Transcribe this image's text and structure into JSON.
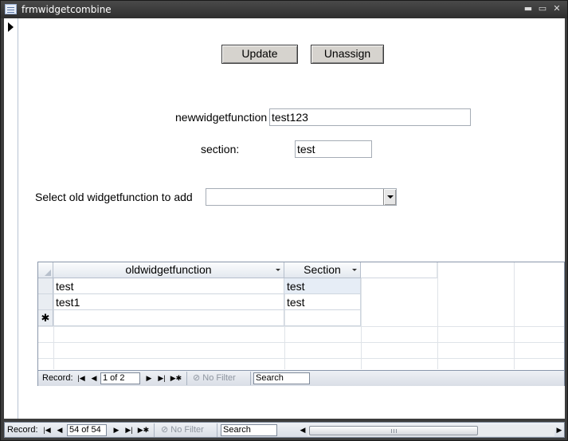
{
  "window": {
    "title": "frmwidgetcombine",
    "controls": {
      "minimize": "▬",
      "restore": "▭",
      "close": "✕"
    }
  },
  "form": {
    "buttons": {
      "update": "Update",
      "unassign": "Unassign"
    },
    "newwidget_label": "newwidgetfunction",
    "newwidget_value": "test123",
    "section_label": "section:",
    "section_value": "test",
    "select_old_label": "Select old widgetfunction to add",
    "select_old_value": ""
  },
  "subform": {
    "columns": [
      "oldwidgetfunction",
      "Section"
    ],
    "rows": [
      {
        "oldwidgetfunction": "test",
        "section": "test"
      },
      {
        "oldwidgetfunction": "test1",
        "section": "test"
      }
    ],
    "new_row_marker": "✱",
    "nav": {
      "record_label": "Record:",
      "position": "1 of 2",
      "no_filter": "No Filter",
      "search_placeholder": "Search"
    }
  },
  "main_nav": {
    "record_label": "Record:",
    "position": "54 of 54",
    "no_filter": "No Filter",
    "search_placeholder": "Search"
  },
  "nav_glyphs": {
    "first": "|◀",
    "prev": "◀",
    "next": "▶",
    "last": "▶|",
    "new": "▶✱",
    "scroll_left": "◀",
    "scroll_right": "▶"
  }
}
